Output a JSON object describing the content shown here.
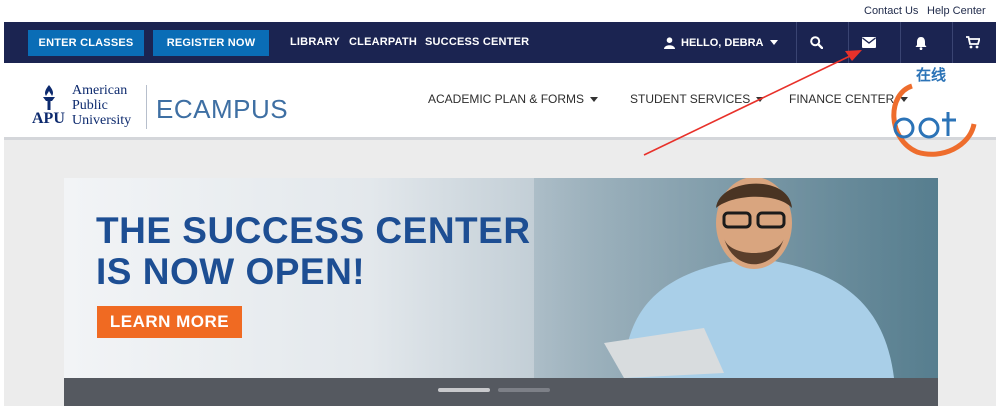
{
  "utility": {
    "contact": "Contact Us",
    "help": "Help Center"
  },
  "topnav": {
    "enter_classes": "ENTER CLASSES",
    "register_now": "REGISTER NOW",
    "library": "LIBRARY",
    "clearpath": "CLEARPATH",
    "success_center": "SUCCESS CENTER",
    "user_greeting": "HELLO, DEBRA",
    "icons": [
      "search-icon",
      "envelope-icon",
      "bell-icon",
      "cart-icon"
    ]
  },
  "header": {
    "logo_apu": "APU",
    "logo_line1": "American",
    "logo_line2": "Public",
    "logo_line3": "University",
    "ecampus": "ECAMPUS",
    "menu": [
      "ACADEMIC PLAN & FORMS",
      "STUDENT SERVICES",
      "FINANCE CENTER"
    ]
  },
  "hero": {
    "line1": "THE SUCCESS CENTER",
    "line2": "IS NOW OPEN!",
    "cta": "LEARN MORE"
  },
  "watermark": {
    "text": "在线"
  },
  "colors": {
    "navy": "#1b2451",
    "button_blue": "#0a6db6",
    "headline_blue": "#1d4e93",
    "cta_orange": "#f06a22",
    "annotation_red": "#e8312a"
  }
}
